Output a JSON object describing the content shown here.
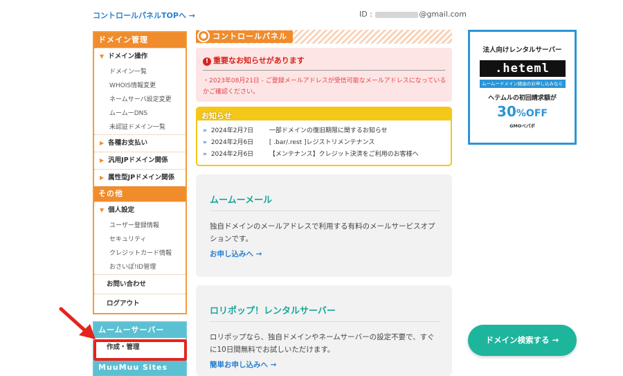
{
  "topbar": {
    "top_link": "コントロールパネルTOPへ →",
    "id_label": "ID :",
    "id_suffix": "@gmail.com"
  },
  "sidebar": {
    "domain_head": "ドメイン管理",
    "domain_ops": "ドメイン操作",
    "domain_ops_items": [
      "ドメイン一覧",
      "WHOIS情報変更",
      "ネームサーバ設定変更",
      "ムームーDNS",
      "未認証ドメイン一覧"
    ],
    "payment": "各種お支払い",
    "jp_general": "汎用JPドメイン関係",
    "jp_attribute": "属性型JPドメイン関係",
    "other_head": "その他",
    "personal": "個人設定",
    "personal_items": [
      "ユーザー登録情報",
      "セキュリティ",
      "クレジットカード情報",
      "おさいぽ!ID管理"
    ],
    "contact": "お問い合わせ",
    "logout": "ログアウト",
    "server_head": "ムームーサーバー",
    "server_manage": "作成・管理",
    "sites_head": "MuuMuu Sites"
  },
  "panel": {
    "title": "コントロールパネル"
  },
  "alert": {
    "title": "重要なお知らせがあります",
    "text": "・2023年08月21日 - ご登録メールアドレスが受信可能なメールアドレスになっているかご確認ください。"
  },
  "notice": {
    "label": "お知らせ",
    "items": [
      {
        "date": "2024年2月7日",
        "text": "一部ドメインの復旧期限に関するお知らせ"
      },
      {
        "date": "2024年2月6日",
        "text": "[ .bar/.rest ]レジストリメンテナンス"
      },
      {
        "date": "2024年2月6日",
        "text": "【メンテナンス】クレジット決済をご利用のお客様へ"
      }
    ]
  },
  "mail_card": {
    "title": "ムームーメール",
    "desc": "独自ドメインのメールアドレスで利用する有料のメールサービスオプションです。",
    "link": "お申し込みへ →"
  },
  "lolipop_card": {
    "title": "ロリポップ！レンタルサーバー",
    "desc": "ロリポップなら、独自ドメインやネームサーバーの設定不要で、すぐに10日間無料でお試しいただけます。",
    "link": "簡単お申し込みへ →"
  },
  "ad": {
    "top": "法人向けレンタルサーバー",
    "logo": ".heteml",
    "band": "ムームードメイン経由のお申し込みなら",
    "mid": "ヘテムルの初回請求額が",
    "off_num": "30",
    "off_pct": "%OFF",
    "gmo": "GMOペパボ"
  },
  "search_button": "ドメイン検索する →",
  "colors": {
    "orange": "#f08c2c",
    "teal": "#5bc0d2",
    "green_button": "#1eb59d",
    "alert_red": "#d6241d",
    "highlight_red": "#e5231d"
  }
}
